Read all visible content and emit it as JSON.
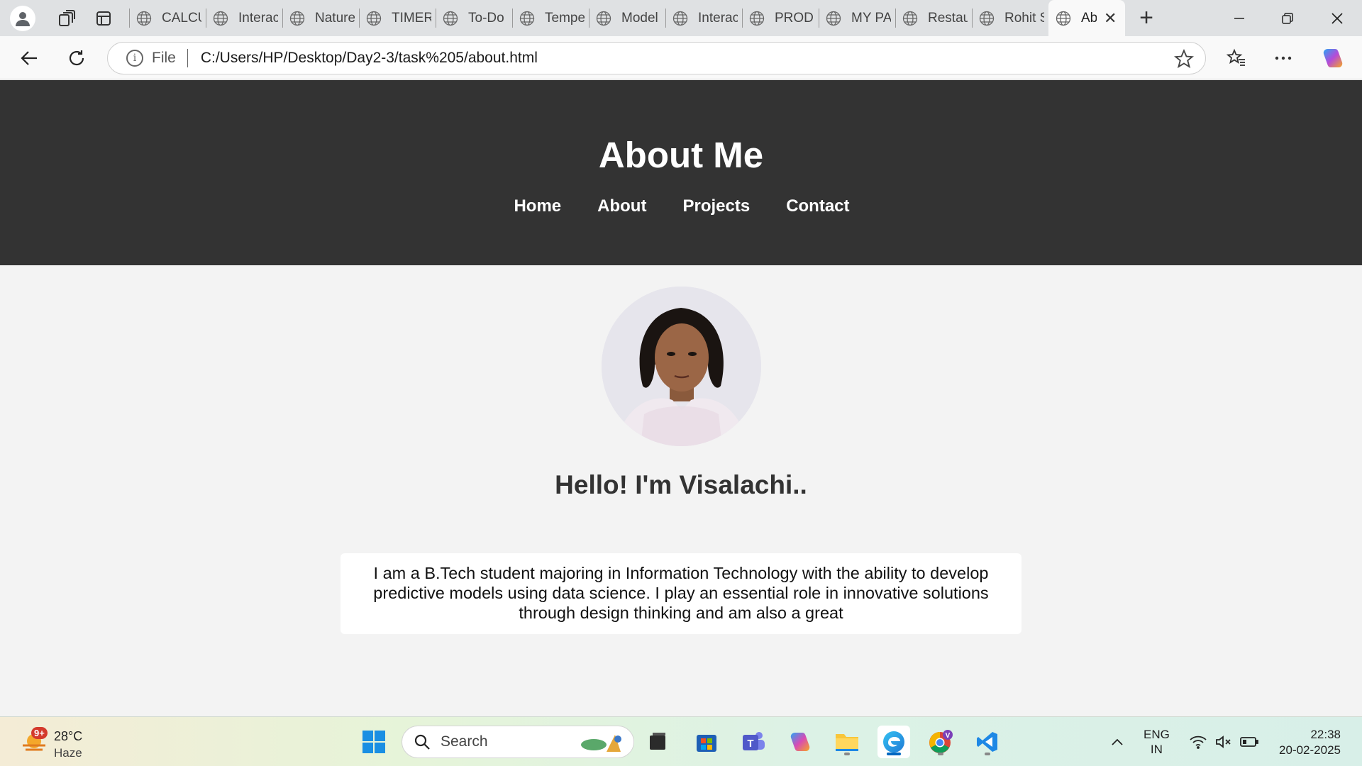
{
  "browser": {
    "tabs": [
      {
        "title": "CALCULATOR"
      },
      {
        "title": "Interactive"
      },
      {
        "title": "Nature"
      },
      {
        "title": "TIMER"
      },
      {
        "title": "To-Do"
      },
      {
        "title": "Temperature"
      },
      {
        "title": "Model"
      },
      {
        "title": "Interactive"
      },
      {
        "title": "PRODUCT"
      },
      {
        "title": "MY PAGE"
      },
      {
        "title": "Restaurant"
      },
      {
        "title": "Rohit S"
      },
      {
        "title": "About"
      }
    ],
    "address": {
      "scheme_label": "File",
      "url": "C:/Users/HP/Desktop/Day2-3/task%205/about.html"
    }
  },
  "site": {
    "title": "About Me",
    "nav": [
      "Home",
      "About",
      "Projects",
      "Contact"
    ],
    "greeting": "Hello! I'm Visalachi..",
    "bio": "I am a B.Tech student majoring in Information Technology with the ability to develop predictive models using data science. I play an essential role in innovative solutions through design thinking and am also a great",
    "colors": {
      "header_bg": "#333333",
      "page_bg": "#f3f3f3"
    }
  },
  "taskbar": {
    "weather": {
      "temp": "28°C",
      "condition": "Haze",
      "badge": "9+"
    },
    "search_placeholder": "Search",
    "language": {
      "line1": "ENG",
      "line2": "IN"
    },
    "time": "22:38",
    "date": "20-02-2025"
  }
}
